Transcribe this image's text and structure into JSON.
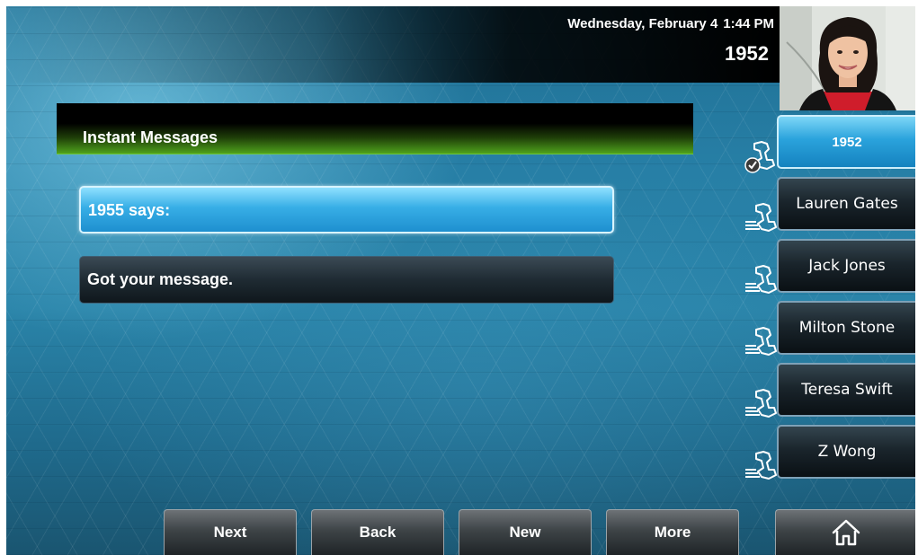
{
  "status_bar": {
    "date": "Wednesday, February 4",
    "time": "1:44 PM",
    "extension": "1952"
  },
  "panel": {
    "title": "Instant Messages"
  },
  "messages": [
    {
      "text": "1955 says:",
      "selected": true
    },
    {
      "text": "Got your message.",
      "selected": false
    }
  ],
  "line_keys": [
    {
      "label": "1952",
      "icon": "registered-line-icon",
      "active": true
    },
    {
      "label": "Lauren Gates",
      "icon": "contact-line-icon",
      "active": false
    },
    {
      "label": "Jack Jones",
      "icon": "contact-line-icon",
      "active": false
    },
    {
      "label": "Milton Stone",
      "icon": "contact-line-icon",
      "active": false
    },
    {
      "label": "Teresa Swift",
      "icon": "contact-line-icon",
      "active": false
    },
    {
      "label": "Z Wong",
      "icon": "contact-line-icon",
      "active": false
    }
  ],
  "soft_keys": {
    "next": "Next",
    "back": "Back",
    "new": "New",
    "more": "More"
  },
  "home_icon": "home-icon",
  "colors": {
    "background": "#277fa6",
    "highlight": "#2aa3dc",
    "title_green": "#4fa21c"
  }
}
